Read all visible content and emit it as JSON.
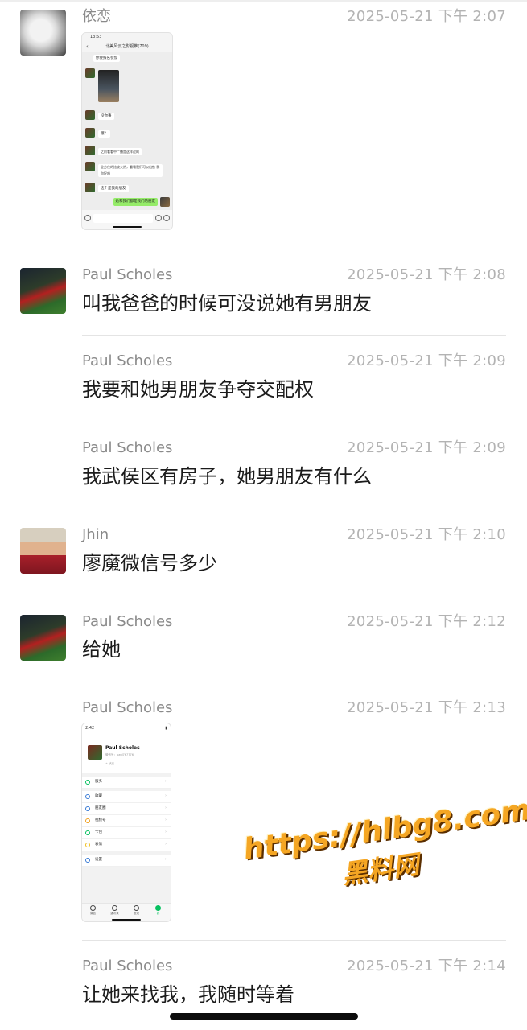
{
  "messages": [
    {
      "sender": "依恋",
      "time": "2025-05-21 下午 2:07",
      "type": "image",
      "avatar": "white-cat",
      "image": {
        "kind": "chat-screenshot",
        "status_time": "13:53",
        "chat_title": "北美风云之影视推(709)",
        "lines": [
          "你要报名参加",
          "没你事",
          "哦？",
          "之前看看中广播是这样过的",
          "全方位的比较火热，看看我们可以出售 我你好吗",
          "这个是我的朋友"
        ],
        "green_bubble": "她和我们都是我们的朋友"
      }
    },
    {
      "sender": "Paul Scholes",
      "time": "2025-05-21 下午 2:08",
      "type": "text",
      "avatar": "football-player",
      "text": "叫我爸爸的时候可没说她有男朋友"
    },
    {
      "sender": "Paul Scholes",
      "time": "2025-05-21 下午 2:09",
      "type": "text",
      "text": "我要和她男朋友争夺交配权"
    },
    {
      "sender": "Paul Scholes",
      "time": "2025-05-21 下午 2:09",
      "type": "text",
      "text": "我武侯区有房子，她男朋友有什么"
    },
    {
      "sender": "Jhin",
      "time": "2025-05-21 下午 2:10",
      "type": "text",
      "avatar": "cartoon-man",
      "text": "廖魔微信号多少"
    },
    {
      "sender": "Paul Scholes",
      "time": "2025-05-21 下午 2:12",
      "type": "text",
      "avatar": "football-player",
      "text": "给她"
    },
    {
      "sender": "Paul Scholes",
      "time": "2025-05-21 下午 2:13",
      "type": "image",
      "image": {
        "kind": "profile-screenshot",
        "status_time": "2:42",
        "profile_name": "Paul Scholes",
        "profile_id": "微信号：paul767776",
        "profile_status": "+ 状态",
        "menu": [
          "服务",
          "收藏",
          "朋友圈",
          "视频号",
          "卡包",
          "表情",
          "设置"
        ],
        "tabs": [
          "微信",
          "通讯录",
          "发现",
          "我"
        ]
      }
    },
    {
      "sender": "Paul Scholes",
      "time": "2025-05-21 下午 2:14",
      "type": "text",
      "text": "让她来找我，我随时等着"
    }
  ],
  "watermark": {
    "url": "https://hlbg8.com",
    "label": "黑料网",
    "color": "#f5a623"
  },
  "colors": {
    "name": "#8a8a8a",
    "time": "#b3b3b3",
    "text": "#1b1b1b",
    "separator": "#e4e4e4",
    "green_bubble": "#95ec69"
  }
}
